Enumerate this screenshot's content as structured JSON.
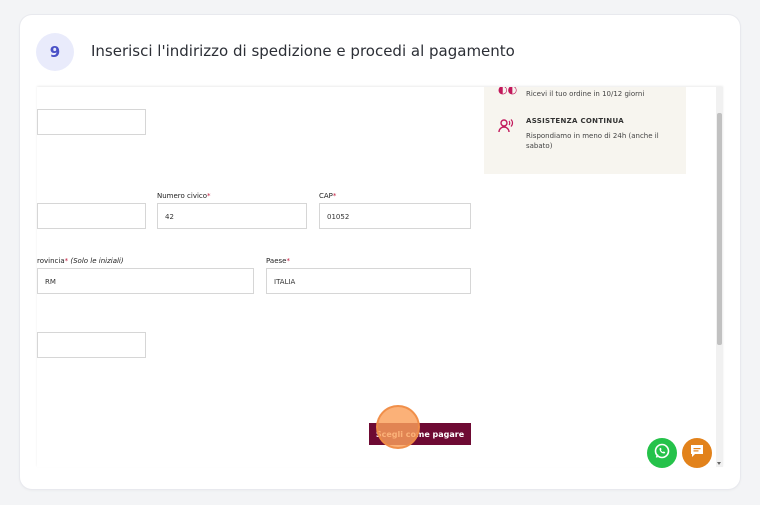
{
  "step": {
    "number": "9",
    "title": "Inserisci l'indirizzo di spedizione e procedi al pagamento"
  },
  "form": {
    "numero_civico": {
      "label": "Numero civico",
      "value": "42"
    },
    "cap": {
      "label": "CAP",
      "value": "01052"
    },
    "provincia": {
      "label": "rovincia",
      "hint": "(Solo le iniziali)",
      "value": "RM"
    },
    "paese": {
      "label": "Paese",
      "value": "ITALIA"
    },
    "required_marker": "*"
  },
  "info": {
    "delivery_text": "Ricevi il tuo ordine in 10/12 giorni",
    "support_heading": "ASSISTENZA CONTINUA",
    "support_text": "Rispondiamo in meno di 24h (anche il sabato)"
  },
  "pay_button": {
    "label": "Scegli come pagare"
  },
  "colors": {
    "accent": "#4a51c7",
    "button": "#6e0a33",
    "whatsapp": "#25c24a",
    "chat": "#e2821b",
    "required": "#c21a3c"
  },
  "icons": {
    "delivery": "truck-icon",
    "support": "headset-icon",
    "whatsapp": "whatsapp-icon",
    "chat": "chat-bubble-icon"
  }
}
